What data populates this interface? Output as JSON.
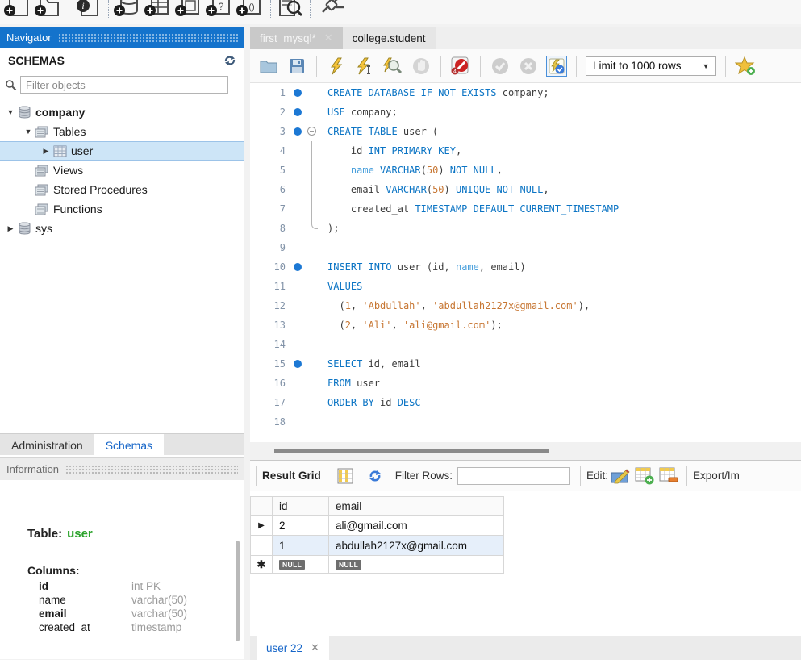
{
  "app": {
    "top_toolbar_icons": [
      {
        "name": "new-sql-tab-icon",
        "glyph": "doc-plus"
      },
      {
        "name": "open-sql-file-icon",
        "glyph": "folder-plus"
      },
      {
        "name": "sep"
      },
      {
        "name": "inline-help-icon",
        "glyph": "doc-info"
      },
      {
        "name": "sep"
      },
      {
        "name": "create-schema-icon",
        "glyph": "db-plus"
      },
      {
        "name": "create-table-icon",
        "glyph": "table-plus"
      },
      {
        "name": "create-view-icon",
        "glyph": "view-plus"
      },
      {
        "name": "create-procedure-icon",
        "glyph": "proc-plus"
      },
      {
        "name": "create-function-icon",
        "glyph": "func-plus"
      },
      {
        "name": "sep"
      },
      {
        "name": "search-objects-icon",
        "glyph": "search-doc"
      },
      {
        "name": "sep"
      },
      {
        "name": "reconnect-dbms-icon",
        "glyph": "plug"
      }
    ]
  },
  "navigator": {
    "title": "Navigator",
    "section": "SCHEMAS",
    "filter_placeholder": "Filter objects",
    "tree": [
      {
        "id": "company",
        "label": "company",
        "level": 0,
        "arrow": "down",
        "icon": "database",
        "bold": true,
        "selected": false
      },
      {
        "id": "tables",
        "label": "Tables",
        "level": 1,
        "arrow": "down",
        "icon": "folder",
        "bold": false,
        "selected": false
      },
      {
        "id": "user",
        "label": "user",
        "level": 2,
        "arrow": "right",
        "icon": "table",
        "bold": false,
        "selected": true
      },
      {
        "id": "views",
        "label": "Views",
        "level": 1,
        "arrow": "none",
        "icon": "folder",
        "bold": false,
        "selected": false
      },
      {
        "id": "stored-procedures",
        "label": "Stored Procedures",
        "level": 1,
        "arrow": "none",
        "icon": "folder",
        "bold": false,
        "selected": false
      },
      {
        "id": "functions",
        "label": "Functions",
        "level": 1,
        "arrow": "none",
        "icon": "folder",
        "bold": false,
        "selected": false
      },
      {
        "id": "sys",
        "label": "sys",
        "level": 0,
        "arrow": "right",
        "icon": "database",
        "bold": false,
        "selected": false
      }
    ],
    "bottom_tabs": [
      {
        "label": "Administration",
        "active": false
      },
      {
        "label": "Schemas",
        "active": true
      }
    ]
  },
  "information": {
    "title": "Information",
    "table_label": "Table:",
    "table_name": "user",
    "columns_label": "Columns:",
    "columns": [
      {
        "name": "id",
        "type": "int PK",
        "style": "pk"
      },
      {
        "name": "name",
        "type": "varchar(50)",
        "style": "plain"
      },
      {
        "name": "email",
        "type": "varchar(50)",
        "style": "bold"
      },
      {
        "name": "created_at",
        "type": "timestamp",
        "style": "plain"
      }
    ]
  },
  "editor": {
    "tabs": [
      {
        "label": "first_mysql*",
        "active": true,
        "closable": true
      },
      {
        "label": "college.student",
        "active": false,
        "closable": false
      }
    ],
    "limit_dropdown": "Limit to 1000 rows",
    "lines": [
      {
        "n": 1,
        "dot": true,
        "fold": "",
        "tokens": [
          [
            "kw",
            "CREATE DATABASE IF NOT EXISTS"
          ],
          [
            "pl",
            " company;"
          ]
        ]
      },
      {
        "n": 2,
        "dot": true,
        "fold": "",
        "tokens": [
          [
            "kw",
            "USE"
          ],
          [
            "pl",
            " company;"
          ]
        ]
      },
      {
        "n": 3,
        "dot": true,
        "fold": "start",
        "tokens": [
          [
            "kw",
            "CREATE TABLE"
          ],
          [
            "pl",
            " user ("
          ]
        ]
      },
      {
        "n": 4,
        "dot": false,
        "fold": "mid",
        "tokens": [
          [
            "pl",
            "    id "
          ],
          [
            "kw",
            "INT PRIMARY KEY"
          ],
          [
            "pl",
            ","
          ]
        ]
      },
      {
        "n": 5,
        "dot": false,
        "fold": "mid",
        "tokens": [
          [
            "pl",
            "    "
          ],
          [
            "kw2",
            "name"
          ],
          [
            "pl",
            " "
          ],
          [
            "kw",
            "VARCHAR"
          ],
          [
            "pl",
            "("
          ],
          [
            "num",
            "50"
          ],
          [
            "pl",
            ") "
          ],
          [
            "kw",
            "NOT NULL"
          ],
          [
            "pl",
            ","
          ]
        ]
      },
      {
        "n": 6,
        "dot": false,
        "fold": "mid",
        "tokens": [
          [
            "pl",
            "    email "
          ],
          [
            "kw",
            "VARCHAR"
          ],
          [
            "pl",
            "("
          ],
          [
            "num",
            "50"
          ],
          [
            "pl",
            ") "
          ],
          [
            "kw",
            "UNIQUE NOT NULL"
          ],
          [
            "pl",
            ","
          ]
        ]
      },
      {
        "n": 7,
        "dot": false,
        "fold": "mid",
        "tokens": [
          [
            "pl",
            "    created_at "
          ],
          [
            "kw",
            "TIMESTAMP DEFAULT CURRENT_TIMESTAMP"
          ]
        ]
      },
      {
        "n": 8,
        "dot": false,
        "fold": "end",
        "tokens": [
          [
            "pl",
            ");"
          ]
        ]
      },
      {
        "n": 9,
        "dot": false,
        "fold": "",
        "tokens": []
      },
      {
        "n": 10,
        "dot": true,
        "fold": "",
        "tokens": [
          [
            "kw",
            "INSERT INTO"
          ],
          [
            "pl",
            " user (id, "
          ],
          [
            "kw2",
            "name"
          ],
          [
            "pl",
            ", email)"
          ]
        ]
      },
      {
        "n": 11,
        "dot": false,
        "fold": "",
        "tokens": [
          [
            "kw",
            "VALUES"
          ]
        ]
      },
      {
        "n": 12,
        "dot": false,
        "fold": "",
        "tokens": [
          [
            "pl",
            "  ("
          ],
          [
            "num",
            "1"
          ],
          [
            "pl",
            ", "
          ],
          [
            "str",
            "'Abdullah'"
          ],
          [
            "pl",
            ", "
          ],
          [
            "str",
            "'abdullah2127x@gmail.com'"
          ],
          [
            "pl",
            "),"
          ]
        ]
      },
      {
        "n": 13,
        "dot": false,
        "fold": "",
        "tokens": [
          [
            "pl",
            "  ("
          ],
          [
            "num",
            "2"
          ],
          [
            "pl",
            ", "
          ],
          [
            "str",
            "'Ali'"
          ],
          [
            "pl",
            ", "
          ],
          [
            "str",
            "'ali@gmail.com'"
          ],
          [
            "pl",
            ");"
          ]
        ]
      },
      {
        "n": 14,
        "dot": false,
        "fold": "",
        "tokens": []
      },
      {
        "n": 15,
        "dot": true,
        "fold": "",
        "tokens": [
          [
            "kw",
            "SELECT"
          ],
          [
            "pl",
            " id, email"
          ]
        ]
      },
      {
        "n": 16,
        "dot": false,
        "fold": "",
        "tokens": [
          [
            "kw",
            "FROM"
          ],
          [
            "pl",
            " user"
          ]
        ]
      },
      {
        "n": 17,
        "dot": false,
        "fold": "",
        "tokens": [
          [
            "kw",
            "ORDER BY"
          ],
          [
            "pl",
            " id "
          ],
          [
            "kw",
            "DESC"
          ]
        ]
      },
      {
        "n": 18,
        "dot": false,
        "fold": "",
        "tokens": []
      }
    ]
  },
  "result_grid": {
    "panel_label": "Result Grid",
    "filter_label": "Filter Rows:",
    "filter_value": "",
    "edit_label": "Edit:",
    "export_label": "Export/Im",
    "table": {
      "columns": [
        "id",
        "email"
      ],
      "rows": [
        {
          "id": "2",
          "email": "ali@gmail.com",
          "highlight": false,
          "marker": "arrow"
        },
        {
          "id": "1",
          "email": "abdullah2127x@gmail.com",
          "highlight": true,
          "marker": ""
        }
      ],
      "null_row": {
        "id": "NULL",
        "email": "NULL",
        "marker": "star"
      }
    },
    "bottom_tab": "user 22"
  },
  "colors": {
    "accent_blue": "#1473cc",
    "keyword_blue": "#0b74c4",
    "soft_keyword_blue": "#4aa0dc",
    "literal_orange": "#c77632",
    "link_blue": "#1565c8",
    "table_name_green": "#2ca32c",
    "tree_selection": "#cde5f7"
  }
}
